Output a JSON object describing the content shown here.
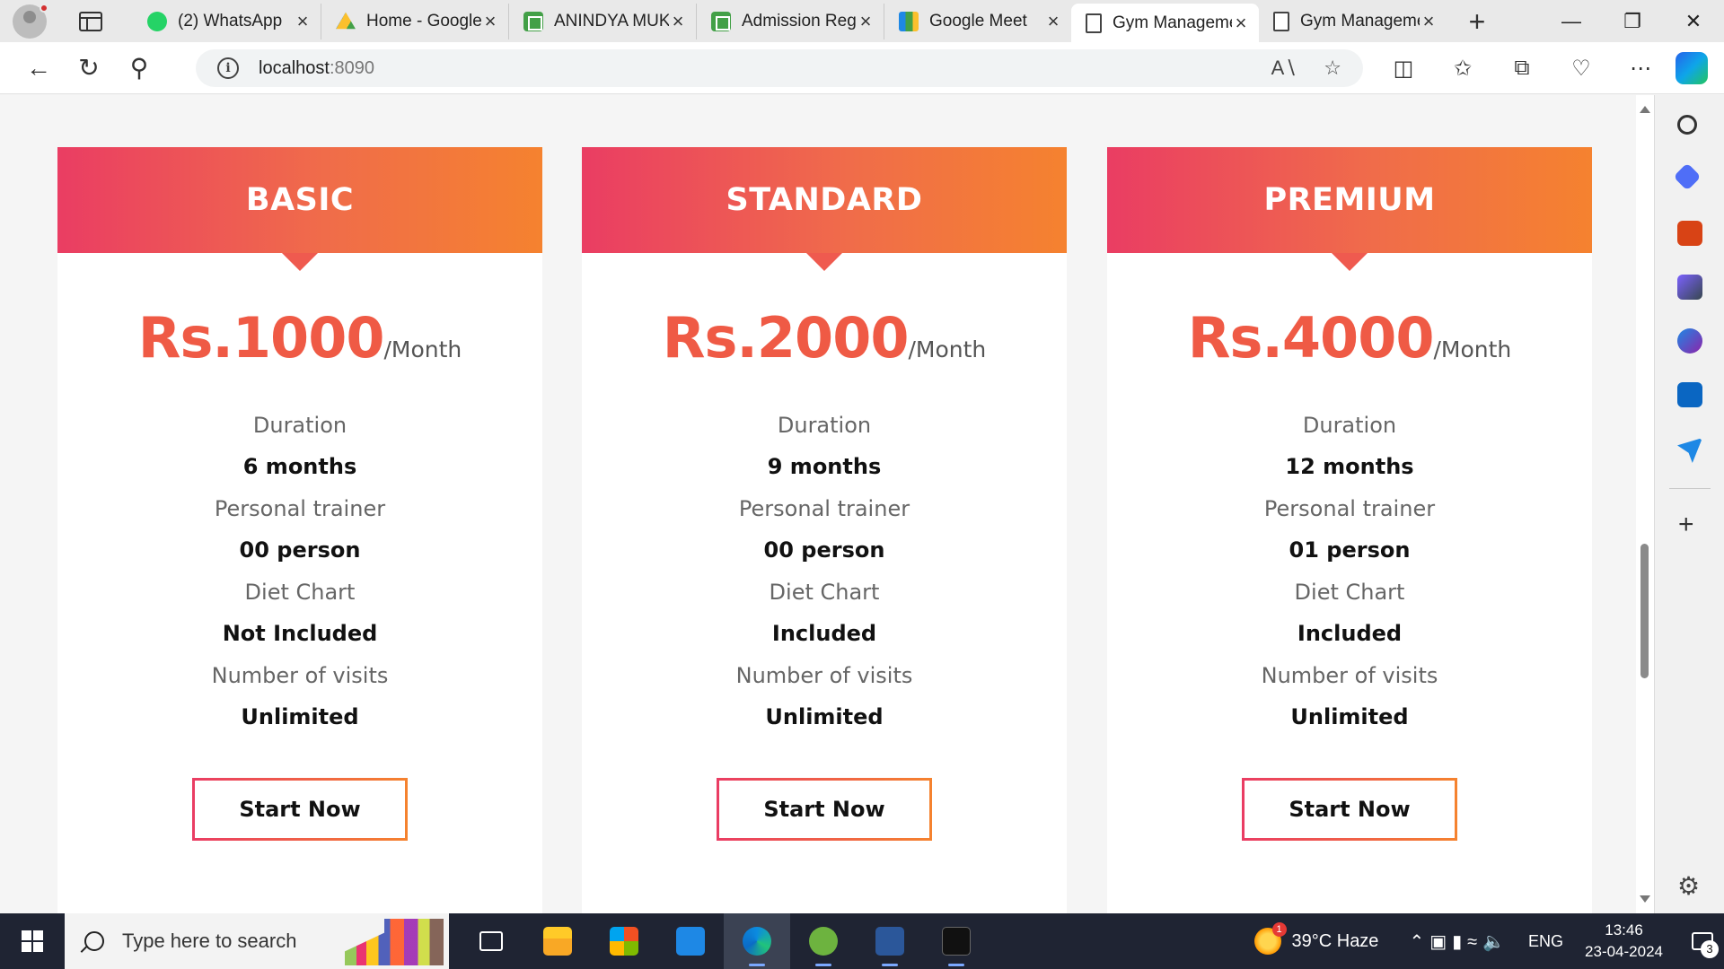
{
  "browser": {
    "tabs": [
      {
        "title": "(2) WhatsApp",
        "icon": "whatsapp-icon"
      },
      {
        "title": "Home - Google Drive",
        "icon": "google-drive-icon"
      },
      {
        "title": "ANINDYA MUKHERJEE",
        "icon": "google-sheets-icon"
      },
      {
        "title": "Admission Register",
        "icon": "google-sheets-icon"
      },
      {
        "title": "Google Meet",
        "icon": "google-meet-icon"
      },
      {
        "title": "Gym Management",
        "icon": "page-icon",
        "active": true
      },
      {
        "title": "Gym Management",
        "icon": "page-icon"
      }
    ],
    "url_host": "localhost",
    "url_port": ":8090",
    "window_controls": {
      "minimize": "—",
      "restore": "❐",
      "close": "✕"
    }
  },
  "pricing": {
    "cta_label": "Start Now",
    "plans": [
      {
        "name": "BASIC",
        "price": "Rs.1000",
        "period": "/Month",
        "features": [
          {
            "label": "Duration",
            "value": "6 months"
          },
          {
            "label": "Personal trainer",
            "value": "00 person"
          },
          {
            "label": "Diet Chart",
            "value": "Not Included"
          },
          {
            "label": "Number of visits",
            "value": "Unlimited"
          }
        ]
      },
      {
        "name": "STANDARD",
        "price": "Rs.2000",
        "period": "/Month",
        "features": [
          {
            "label": "Duration",
            "value": "9 months"
          },
          {
            "label": "Personal trainer",
            "value": "00 person"
          },
          {
            "label": "Diet Chart",
            "value": "Included"
          },
          {
            "label": "Number of visits",
            "value": "Unlimited"
          }
        ]
      },
      {
        "name": "PREMIUM",
        "price": "Rs.4000",
        "period": "/Month",
        "features": [
          {
            "label": "Duration",
            "value": "12 months"
          },
          {
            "label": "Personal trainer",
            "value": "01 person"
          },
          {
            "label": "Diet Chart",
            "value": "Included"
          },
          {
            "label": "Number of visits",
            "value": "Unlimited"
          }
        ]
      }
    ],
    "colors": {
      "accent_start": "#ea3d63",
      "accent_end": "#f5822f",
      "price": "#ef5a45"
    }
  },
  "taskbar": {
    "search_placeholder": "Type here to search",
    "weather": "39°C  Haze",
    "weather_badge": "1",
    "language": "ENG",
    "time": "13:46",
    "date": "23-04-2024",
    "notifications": "3"
  }
}
